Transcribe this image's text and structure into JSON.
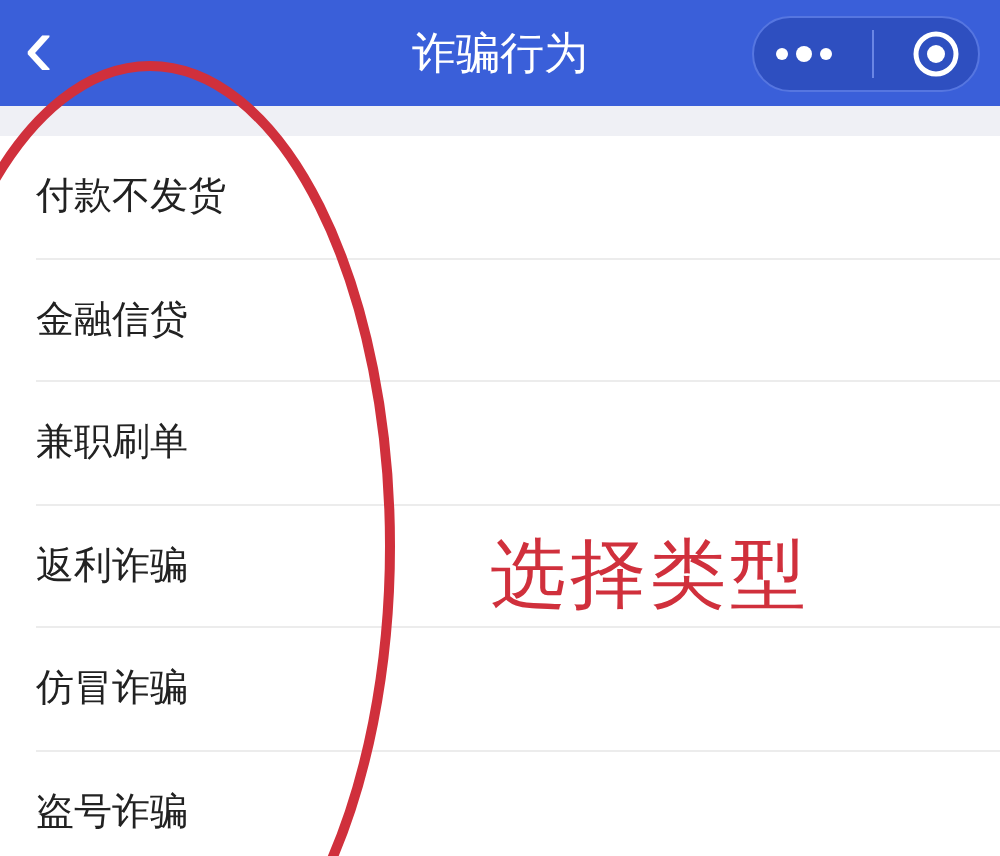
{
  "nav_bar": {
    "back_icon": "‹",
    "title": "诈骗行为"
  },
  "items": [
    "付款不发货",
    "金融信贷",
    "兼职刷单",
    "返利诈骗",
    "仿冒诈骗",
    "盗号诈骗"
  ],
  "annotation": {
    "text": "选择类型"
  }
}
